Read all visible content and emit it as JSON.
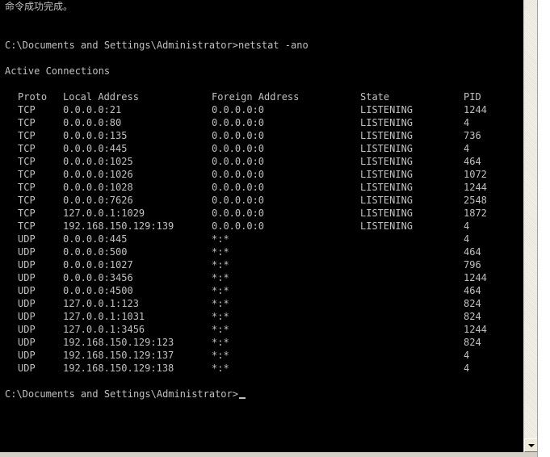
{
  "console": {
    "top_line": "命令成功完成。",
    "prompt1": "C:\\Documents and Settings\\Administrator>netstat -ano",
    "heading": "Active Connections",
    "columns": {
      "proto": "Proto",
      "local": "Local Address",
      "foreign": "Foreign Address",
      "state": "State",
      "pid": "PID"
    },
    "rows": [
      {
        "proto": "TCP",
        "local": "0.0.0.0:21",
        "foreign": "0.0.0.0:0",
        "state": "LISTENING",
        "pid": "1244"
      },
      {
        "proto": "TCP",
        "local": "0.0.0.0:80",
        "foreign": "0.0.0.0:0",
        "state": "LISTENING",
        "pid": "4"
      },
      {
        "proto": "TCP",
        "local": "0.0.0.0:135",
        "foreign": "0.0.0.0:0",
        "state": "LISTENING",
        "pid": "736"
      },
      {
        "proto": "TCP",
        "local": "0.0.0.0:445",
        "foreign": "0.0.0.0:0",
        "state": "LISTENING",
        "pid": "4"
      },
      {
        "proto": "TCP",
        "local": "0.0.0.0:1025",
        "foreign": "0.0.0.0:0",
        "state": "LISTENING",
        "pid": "464"
      },
      {
        "proto": "TCP",
        "local": "0.0.0.0:1026",
        "foreign": "0.0.0.0:0",
        "state": "LISTENING",
        "pid": "1072"
      },
      {
        "proto": "TCP",
        "local": "0.0.0.0:1028",
        "foreign": "0.0.0.0:0",
        "state": "LISTENING",
        "pid": "1244"
      },
      {
        "proto": "TCP",
        "local": "0.0.0.0:7626",
        "foreign": "0.0.0.0:0",
        "state": "LISTENING",
        "pid": "2548"
      },
      {
        "proto": "TCP",
        "local": "127.0.0.1:1029",
        "foreign": "0.0.0.0:0",
        "state": "LISTENING",
        "pid": "1872"
      },
      {
        "proto": "TCP",
        "local": "192.168.150.129:139",
        "foreign": "0.0.0.0:0",
        "state": "LISTENING",
        "pid": "4"
      },
      {
        "proto": "UDP",
        "local": "0.0.0.0:445",
        "foreign": "*:*",
        "state": "",
        "pid": "4"
      },
      {
        "proto": "UDP",
        "local": "0.0.0.0:500",
        "foreign": "*:*",
        "state": "",
        "pid": "464"
      },
      {
        "proto": "UDP",
        "local": "0.0.0.0:1027",
        "foreign": "*:*",
        "state": "",
        "pid": "796"
      },
      {
        "proto": "UDP",
        "local": "0.0.0.0:3456",
        "foreign": "*:*",
        "state": "",
        "pid": "1244"
      },
      {
        "proto": "UDP",
        "local": "0.0.0.0:4500",
        "foreign": "*:*",
        "state": "",
        "pid": "464"
      },
      {
        "proto": "UDP",
        "local": "127.0.0.1:123",
        "foreign": "*:*",
        "state": "",
        "pid": "824"
      },
      {
        "proto": "UDP",
        "local": "127.0.0.1:1031",
        "foreign": "*:*",
        "state": "",
        "pid": "824"
      },
      {
        "proto": "UDP",
        "local": "127.0.0.1:3456",
        "foreign": "*:*",
        "state": "",
        "pid": "1244"
      },
      {
        "proto": "UDP",
        "local": "192.168.150.129:123",
        "foreign": "*:*",
        "state": "",
        "pid": "824"
      },
      {
        "proto": "UDP",
        "local": "192.168.150.129:137",
        "foreign": "*:*",
        "state": "",
        "pid": "4"
      },
      {
        "proto": "UDP",
        "local": "192.168.150.129:138",
        "foreign": "*:*",
        "state": "",
        "pid": "4"
      }
    ],
    "prompt2": "C:\\Documents and Settings\\Administrator>"
  },
  "colors": {
    "background": "#000000",
    "text": "#c0c0c0"
  },
  "icons": {
    "scroll_down": "chevron-down-icon"
  }
}
